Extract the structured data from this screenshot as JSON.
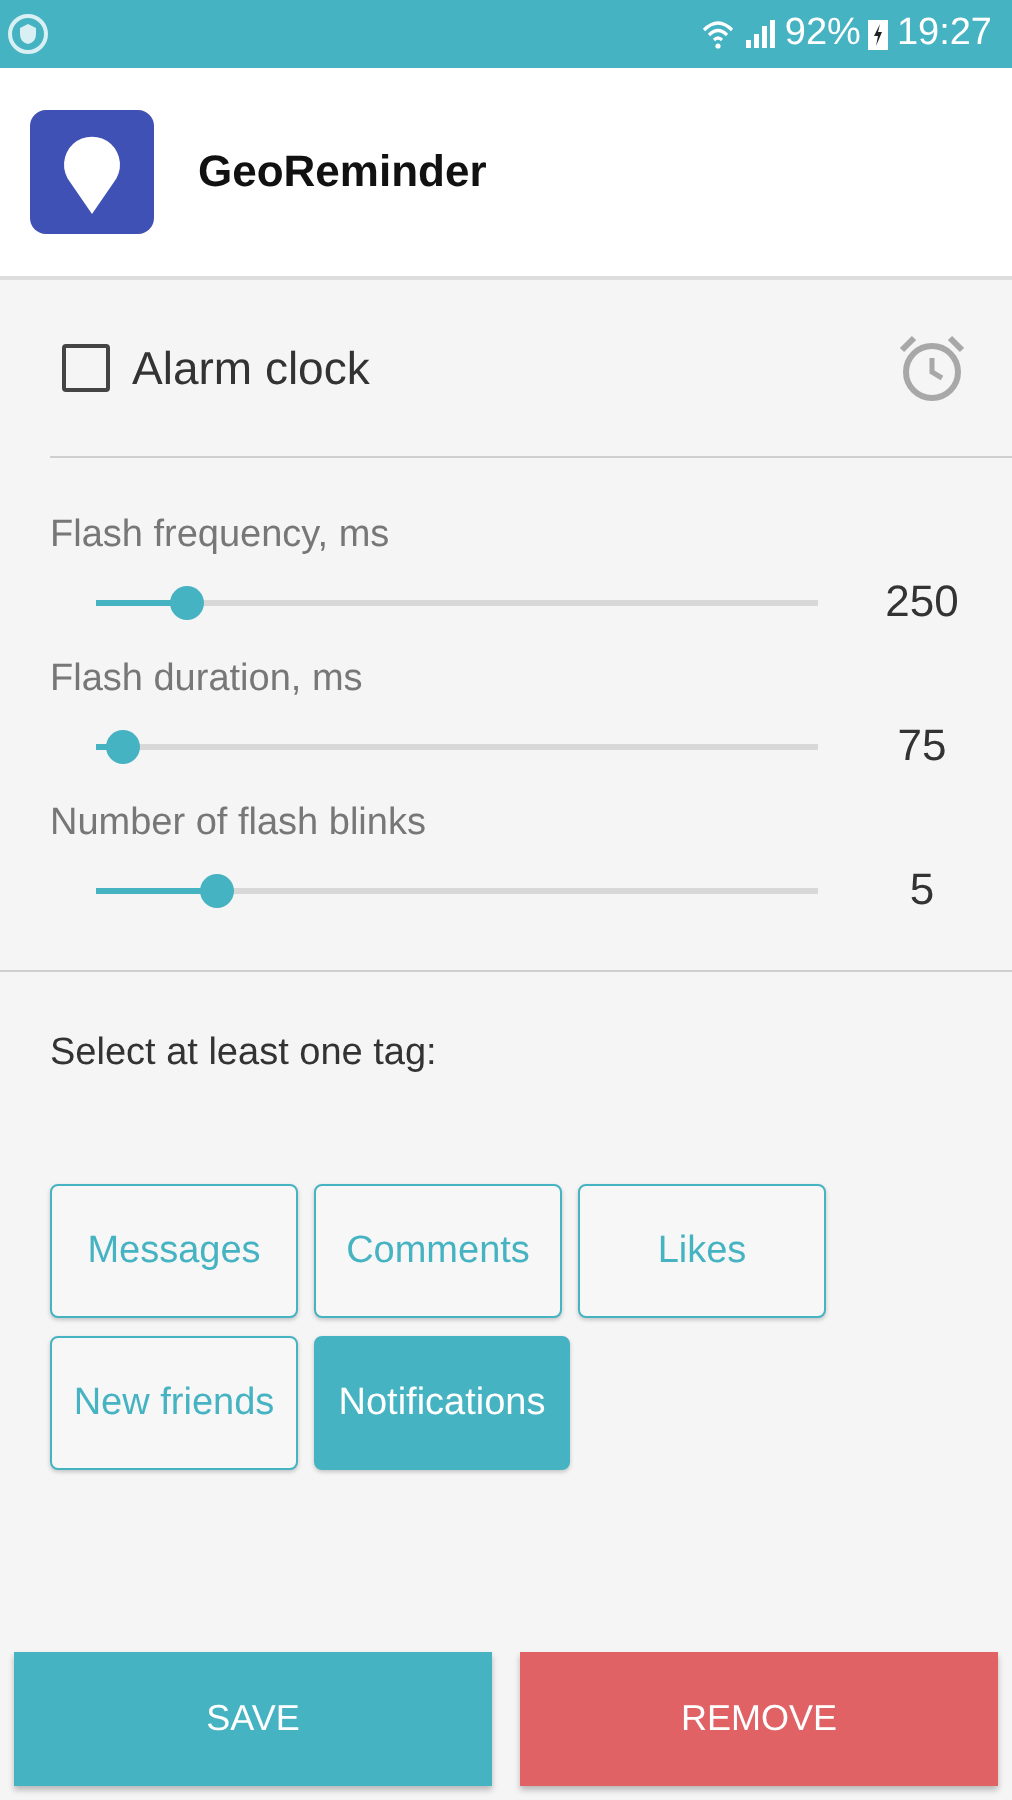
{
  "status_bar": {
    "battery": "92%",
    "time": "19:27"
  },
  "app": {
    "title": "GeoReminder"
  },
  "alarm": {
    "label": "Alarm clock",
    "checked": false
  },
  "sliders": [
    {
      "label": "Flash frequency, ms",
      "level": 0.125,
      "reading": "250"
    },
    {
      "label": "Flash duration, ms",
      "level": 0.036,
      "reading": "75"
    },
    {
      "label": "Number of flash blinks",
      "level": 0.166,
      "reading": "5"
    }
  ],
  "tags_prompt": "Select at least one tag:",
  "tags": [
    {
      "label": "Messages",
      "selected": false
    },
    {
      "label": "Comments",
      "selected": false
    },
    {
      "label": "Likes",
      "selected": false
    },
    {
      "label": "New friends",
      "selected": false
    },
    {
      "label": "Notifications",
      "selected": true
    }
  ],
  "buttons": [
    {
      "label": "SAVE",
      "kind": "save"
    },
    {
      "label": "REMOVE",
      "kind": "remove"
    }
  ]
}
